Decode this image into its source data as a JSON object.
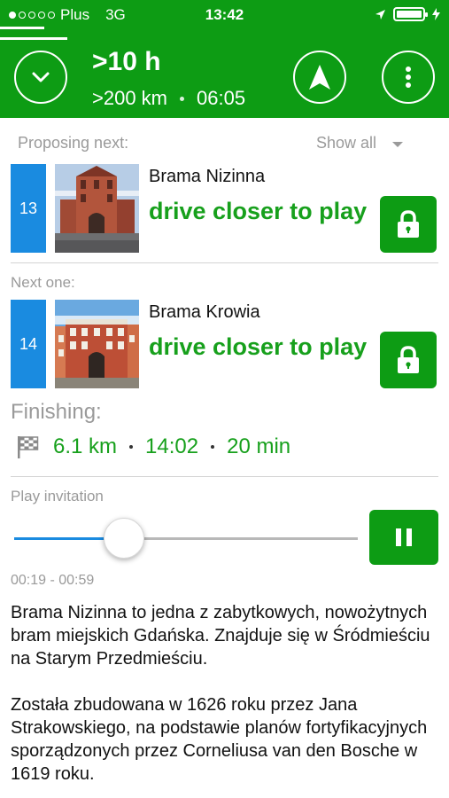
{
  "status_bar": {
    "carrier": "Plus",
    "network": "3G",
    "time": "13:42"
  },
  "header": {
    "eta": ">10 h",
    "distance": ">200  km",
    "arrival_time": "06:05",
    "icons": [
      "chevron-down-icon",
      "navigation-arrow-icon",
      "more-vertical-icon"
    ]
  },
  "proposing": {
    "label": "Proposing next:",
    "show_all": "Show all"
  },
  "cards": [
    {
      "number": "13",
      "title": "Brama Nizinna",
      "action": "drive closer to play"
    },
    {
      "number": "14",
      "title": "Brama Krowia",
      "action": "drive closer to play"
    }
  ],
  "next_label": "Next one:",
  "finishing": {
    "label": "Finishing:",
    "distance": "6.1 km",
    "time": "14:02",
    "duration": "20 min"
  },
  "player": {
    "label": "Play invitation",
    "progress": 0.32,
    "time_range": "00:19 - 00:59"
  },
  "description": {
    "paragraph1": "Brama Nizinna to jedna z zabytkowych, nowożytnych bram miejskich Gdańska. Znajduje się w Śródmieściu na Starym Przedmieściu.",
    "paragraph2": "Została zbudowana w 1626 roku przez Jana Strakowskiego, na podstawie planów fortyfikacyjnych sporządzonych przez Corneliusa van den Bosche w 1619 roku."
  },
  "colors": {
    "brand_green": "#0d9c14",
    "text_green": "#17a01c",
    "accent_blue": "#1a8be0"
  }
}
